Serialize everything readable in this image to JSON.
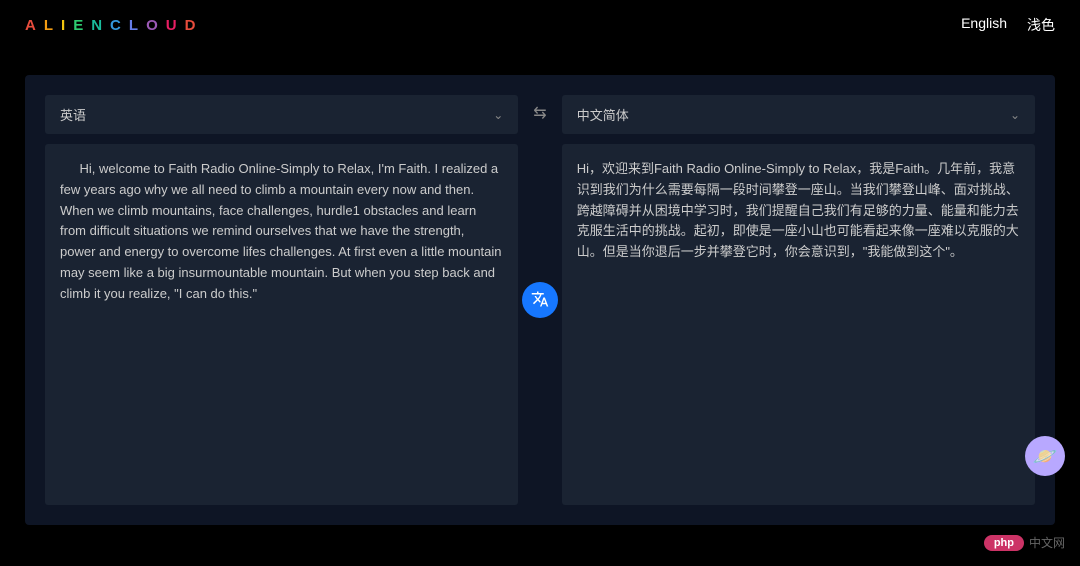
{
  "logo": {
    "chars": [
      "A",
      "L",
      "I",
      "E",
      "N",
      "C",
      "L",
      "O",
      "U",
      "D"
    ]
  },
  "header": {
    "language_label": "English",
    "theme_label": "浅色"
  },
  "translator": {
    "source_lang": "英语",
    "target_lang": "中文简体",
    "source_text": "Hi, welcome to Faith Radio Online-Simply to Relax, I'm Faith. I realized a few years ago why we all need to climb a mountain every now and then. When we climb mountains, face challenges, hurdle1 obstacles and learn from difficult situations we remind ourselves that we have the strength, power and energy to overcome lifes challenges. At first even a little mountain may seem like a big insurmountable mountain. But when you step back and climb it you realize, \"I can do this.\"",
    "target_text": "Hi，欢迎来到Faith Radio Online-Simply to Relax，我是Faith。几年前，我意识到我们为什么需要每隔一段时间攀登一座山。当我们攀登山峰、面对挑战、跨越障碍并从困境中学习时，我们提醒自己我们有足够的力量、能量和能力去克服生活中的挑战。起初，即使是一座小山也可能看起来像一座难以克服的大山。但是当你退后一步并攀登它时，你会意识到，\"我能做到这个\"。"
  },
  "watermark": {
    "badge": "php",
    "text": "中文网"
  }
}
